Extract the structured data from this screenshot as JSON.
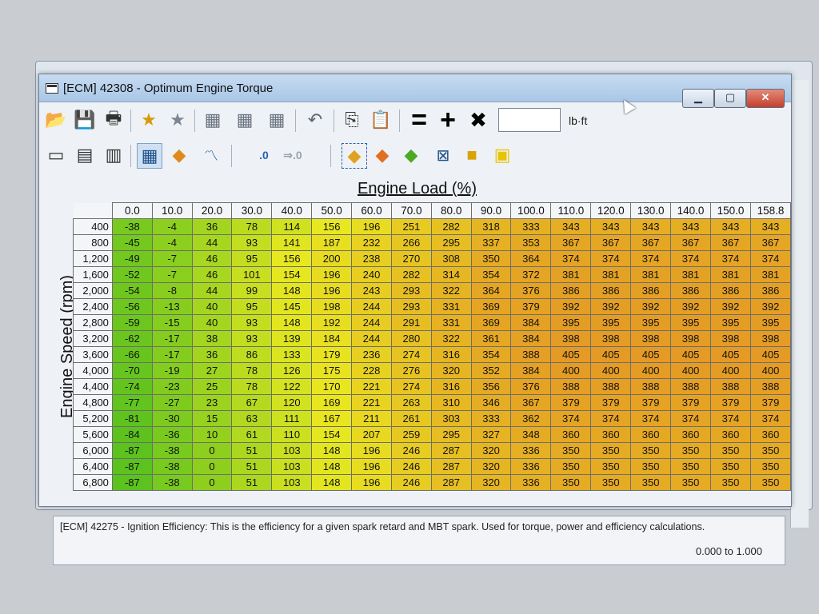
{
  "window": {
    "title": "[ECM] 42308 - Optimum Engine Torque",
    "controls": {
      "minimize": "▁",
      "maximize": "▢",
      "close": "✕"
    }
  },
  "toolbar1": {
    "icons": [
      "open-icon",
      "save-icon",
      "print-icon",
      "favorite-add-icon",
      "favorite-remove-icon",
      "table-icon",
      "table-compare-icon",
      "table-grid-icon",
      "undo-icon",
      "copy-icon",
      "paste-icon",
      "equals-icon",
      "plus-icon",
      "multiply-icon"
    ],
    "glyphs": {
      "open": "📂",
      "save": "💾",
      "print": "🖶",
      "fav_add": "★",
      "fav_remove": "★",
      "table1": "▦",
      "table2": "▦",
      "table3": "▦",
      "undo": "↶",
      "copy": "⎘",
      "paste": "📋",
      "equals": "=",
      "plus": "+",
      "multiply": "✖"
    },
    "value_input": "",
    "unit": "lb·ft"
  },
  "toolbar2": {
    "glyphs": {
      "view1": "▭",
      "view2": "▤",
      "view3": "▥",
      "view4": "▦",
      "surface": "◆",
      "graph": "〽",
      "dec_inc": ".0",
      "dec_inc2": ".00",
      "dec_dec": ".00",
      "dec_dec2": "⇒.0"
    },
    "labels": [
      ".0",
      ".00",
      ".00",
      ".0"
    ]
  },
  "axes": {
    "x_title": "Engine Load (%)",
    "y_title": "Engine Speed (rpm)"
  },
  "table": {
    "columns": [
      "0.0",
      "10.0",
      "20.0",
      "30.0",
      "40.0",
      "50.0",
      "60.0",
      "70.0",
      "80.0",
      "90.0",
      "100.0",
      "110.0",
      "120.0",
      "130.0",
      "140.0",
      "150.0",
      "158.8"
    ],
    "rows": [
      {
        "rpm": "400",
        "values": [
          -38,
          -4,
          36,
          78,
          114,
          156,
          196,
          251,
          282,
          318,
          333,
          343,
          343,
          343,
          343,
          343,
          343
        ]
      },
      {
        "rpm": "800",
        "values": [
          -45,
          -4,
          44,
          93,
          141,
          187,
          232,
          266,
          295,
          337,
          353,
          367,
          367,
          367,
          367,
          367,
          367
        ]
      },
      {
        "rpm": "1,200",
        "values": [
          -49,
          -7,
          46,
          95,
          156,
          200,
          238,
          270,
          308,
          350,
          364,
          374,
          374,
          374,
          374,
          374,
          374
        ]
      },
      {
        "rpm": "1,600",
        "values": [
          -52,
          -7,
          46,
          101,
          154,
          196,
          240,
          282,
          314,
          354,
          372,
          381,
          381,
          381,
          381,
          381,
          381
        ]
      },
      {
        "rpm": "2,000",
        "values": [
          -54,
          -8,
          44,
          99,
          148,
          196,
          243,
          293,
          322,
          364,
          376,
          386,
          386,
          386,
          386,
          386,
          386
        ]
      },
      {
        "rpm": "2,400",
        "values": [
          -56,
          -13,
          40,
          95,
          145,
          198,
          244,
          293,
          331,
          369,
          379,
          392,
          392,
          392,
          392,
          392,
          392
        ]
      },
      {
        "rpm": "2,800",
        "values": [
          -59,
          -15,
          40,
          93,
          148,
          192,
          244,
          291,
          331,
          369,
          384,
          395,
          395,
          395,
          395,
          395,
          395
        ]
      },
      {
        "rpm": "3,200",
        "values": [
          -62,
          -17,
          38,
          93,
          139,
          184,
          244,
          280,
          322,
          361,
          384,
          398,
          398,
          398,
          398,
          398,
          398
        ]
      },
      {
        "rpm": "3,600",
        "values": [
          -66,
          -17,
          36,
          86,
          133,
          179,
          236,
          274,
          316,
          354,
          388,
          405,
          405,
          405,
          405,
          405,
          405
        ]
      },
      {
        "rpm": "4,000",
        "values": [
          -70,
          -19,
          27,
          78,
          126,
          175,
          228,
          276,
          320,
          352,
          384,
          400,
          400,
          400,
          400,
          400,
          400
        ]
      },
      {
        "rpm": "4,400",
        "values": [
          -74,
          -23,
          25,
          78,
          122,
          170,
          221,
          274,
          316,
          356,
          376,
          388,
          388,
          388,
          388,
          388,
          388
        ]
      },
      {
        "rpm": "4,800",
        "values": [
          -77,
          -27,
          23,
          67,
          120,
          169,
          221,
          263,
          310,
          346,
          367,
          379,
          379,
          379,
          379,
          379,
          379
        ]
      },
      {
        "rpm": "5,200",
        "values": [
          -81,
          -30,
          15,
          63,
          111,
          167,
          211,
          261,
          303,
          333,
          362,
          374,
          374,
          374,
          374,
          374,
          374
        ]
      },
      {
        "rpm": "5,600",
        "values": [
          -84,
          -36,
          10,
          61,
          110,
          154,
          207,
          259,
          295,
          327,
          348,
          360,
          360,
          360,
          360,
          360,
          360
        ]
      },
      {
        "rpm": "6,000",
        "values": [
          -87,
          -38,
          0,
          51,
          103,
          148,
          196,
          246,
          287,
          320,
          336,
          350,
          350,
          350,
          350,
          350,
          350
        ]
      },
      {
        "rpm": "6,400",
        "values": [
          -87,
          -38,
          0,
          51,
          103,
          148,
          196,
          246,
          287,
          320,
          336,
          350,
          350,
          350,
          350,
          350,
          350
        ]
      },
      {
        "rpm": "6,800",
        "values": [
          -87,
          -38,
          0,
          51,
          103,
          148,
          196,
          246,
          287,
          320,
          336,
          350,
          350,
          350,
          350,
          350,
          350
        ]
      }
    ],
    "color_range": [
      -87,
      405
    ],
    "colors": {
      "low": "#5cc21e",
      "mid": "#e9e81f",
      "high": "#e49a24"
    }
  },
  "description": {
    "text": "[ECM] 42275 - Ignition Efficiency: This is the efficiency for a given spark retard and MBT spark. Used for torque, power and efficiency calculations.",
    "range": "0.000 to 1.000"
  }
}
